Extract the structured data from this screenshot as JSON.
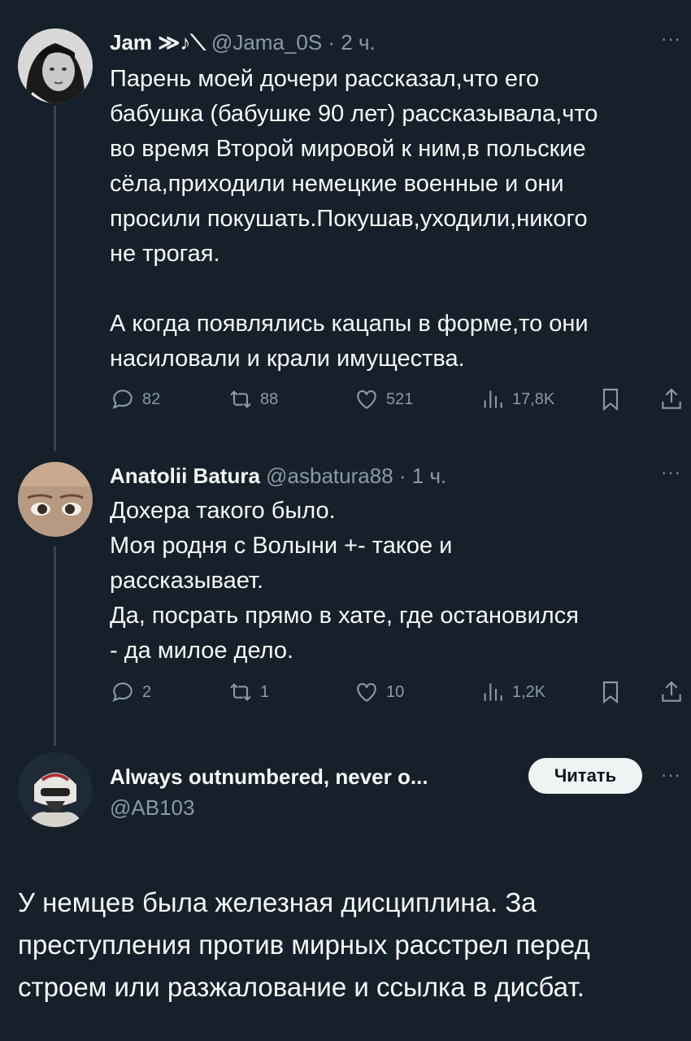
{
  "tweets": [
    {
      "name": "Jam ≫♪⟍",
      "handle": "@Jama_0S",
      "time": "· 2 ч.",
      "text": "Парень моей дочери рассказал,что его\nбабушка (бабушке 90 лет) рассказывала,что\nво время Второй мировой к ним,в польские\nсёла,приходили немецкие военные и они\nпросили покушать.Покушав,уходили,никого\nне трогая.\n\nА когда появлялись кацапы в форме,то они\nнасиловали и крали имущества.",
      "stats": {
        "replies": "82",
        "retweets": "88",
        "likes": "521",
        "views": "17,8K"
      }
    },
    {
      "name": "Anatolii Batura",
      "handle": "@asbatura88",
      "time": "· 1 ч.",
      "text": "Дохера такого было.\nМоя родня с Волыни +- такое и\nрассказывает.\nДа, посрать прямо в хате, где остановился\n- да милое дело.",
      "stats": {
        "replies": "2",
        "retweets": "1",
        "likes": "10",
        "views": "1,2K"
      }
    }
  ],
  "author": {
    "name": "Always outnumbered, never o...",
    "handle": "@AB103",
    "follow_label": "Читать",
    "text": "У немцев была железная дисциплина. За\nпреступления против мирных расстрел перед\nстроем или разжалование и ссылка в дисбат."
  },
  "more_icon": "···",
  "colors": {
    "background": "#15202b",
    "muted": "#8b98a5",
    "button": "#eff3f4"
  }
}
